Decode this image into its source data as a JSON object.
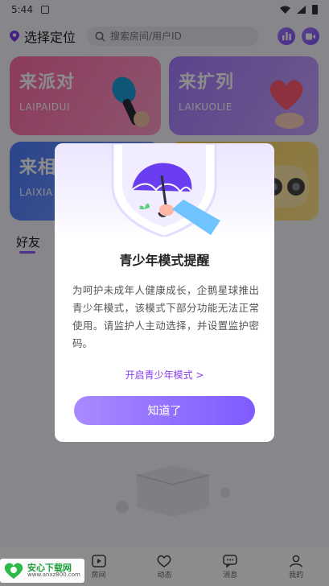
{
  "status_bar": {
    "time": "5:44"
  },
  "topbar": {
    "location_label": "选择定位",
    "search_placeholder": "搜索房间/用户ID"
  },
  "cards": [
    {
      "title": "来派对",
      "subtitle": "LAIPAIDUI"
    },
    {
      "title": "来扩列",
      "subtitle": "LAIKUOLIE"
    },
    {
      "title": "来相",
      "subtitle": "LAIXIA"
    },
    {
      "title": "",
      "subtitle": ""
    }
  ],
  "friends_tab": "好友",
  "bottom_nav": [
    {
      "label": "",
      "icon": "home-icon"
    },
    {
      "label": "房间",
      "icon": "play-icon"
    },
    {
      "label": "动态",
      "icon": "heart-icon"
    },
    {
      "label": "消息",
      "icon": "chat-icon"
    },
    {
      "label": "我的",
      "icon": "user-icon"
    }
  ],
  "watermark": {
    "title": "安心下载网",
    "url": "www.anxz800.com"
  },
  "modal": {
    "title": "青少年模式提醒",
    "body": "为呵护未成年人健康成长，企鹅星球推出青少年模式，该模式下部分功能无法正常使用。请监护人主动选择，并设置监护密码。",
    "link": "开启青少年模式 >",
    "button": "知道了"
  },
  "colors": {
    "accent": "#8a5cff",
    "link": "#8a3cf0",
    "button_gradient": [
      "#a98aff",
      "#7f5bff"
    ]
  }
}
